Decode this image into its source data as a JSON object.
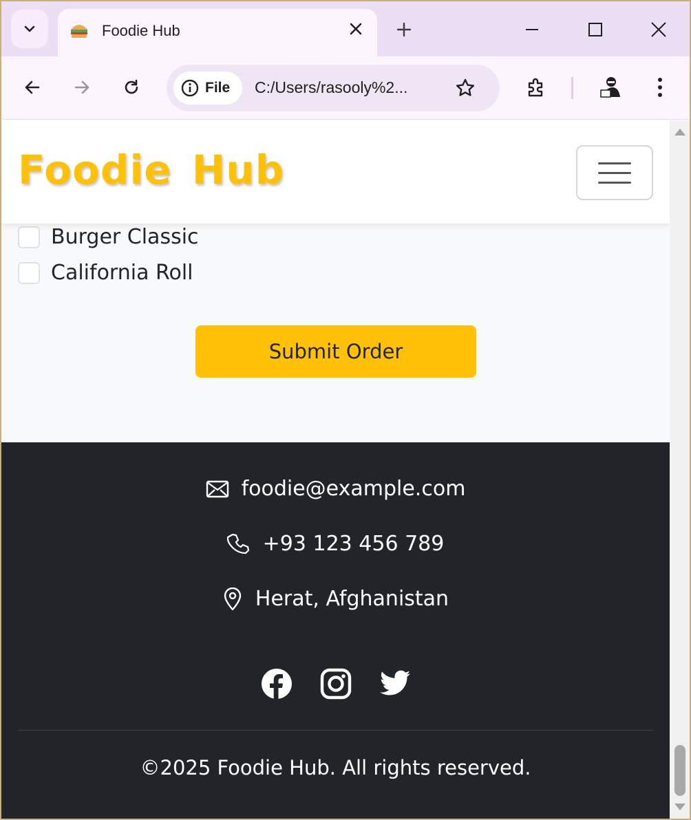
{
  "browser": {
    "tab_title": "Foodie Hub",
    "site_chip_label": "File",
    "url": "C:/Users/rasooly%2..."
  },
  "navbar": {
    "brand": "Foodie Hub"
  },
  "order": {
    "items": [
      {
        "label": "Burger Classic",
        "checked": false
      },
      {
        "label": "California Roll",
        "checked": false
      }
    ],
    "submit_label": "Submit Order"
  },
  "footer": {
    "email": "foodie@example.com",
    "phone": "+93 123 456 789",
    "location": "Herat, Afghanistan",
    "socials": [
      "facebook-icon",
      "instagram-icon",
      "twitter-icon"
    ],
    "copyright": "©2025 Foodie Hub. All rights reserved."
  },
  "colors": {
    "brand": "#ffc107",
    "footer_bg": "#212529",
    "page_bg": "#f8f9fa",
    "tabstrip_bg": "#ebdff5"
  }
}
